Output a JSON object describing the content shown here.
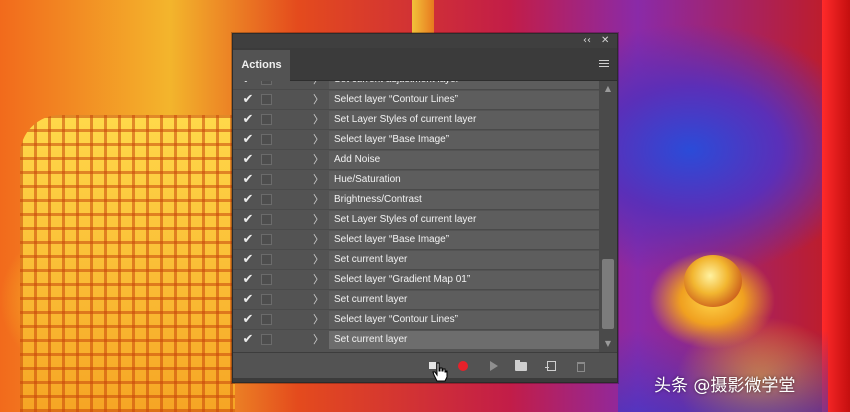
{
  "panel": {
    "title": "Actions",
    "collapse_glyph": "‹‹",
    "close_glyph": "✕",
    "menu_icon": "hamburger-menu-icon"
  },
  "actions": {
    "items": [
      {
        "label": "Set current adjustment layer",
        "checked": true
      },
      {
        "label": "Select layer “Contour Lines”",
        "checked": true
      },
      {
        "label": "Set Layer Styles of current layer",
        "checked": true
      },
      {
        "label": "Select layer “Base Image”",
        "checked": true
      },
      {
        "label": "Add Noise",
        "checked": true
      },
      {
        "label": "Hue/Saturation",
        "checked": true
      },
      {
        "label": "Brightness/Contrast",
        "checked": true
      },
      {
        "label": "Set Layer Styles of current layer",
        "checked": true
      },
      {
        "label": "Select layer “Base Image”",
        "checked": true
      },
      {
        "label": "Set current layer",
        "checked": true
      },
      {
        "label": "Select layer “Gradient Map 01”",
        "checked": true
      },
      {
        "label": "Set current layer",
        "checked": true
      },
      {
        "label": "Select layer “Contour Lines”",
        "checked": true
      },
      {
        "label": "Set current layer",
        "checked": true,
        "selected": true
      }
    ],
    "check_glyph": "✔",
    "expand_glyph": "〉"
  },
  "scrollbar": {
    "up_glyph": "▲",
    "down_glyph": "▼",
    "position": 0.95
  },
  "toolbar": {
    "buttons": [
      "stop-icon",
      "record-icon",
      "play-icon",
      "folder-icon",
      "new-item-icon",
      "trash-icon"
    ],
    "record_color": "#e7212a"
  },
  "watermark": {
    "text": "头条 @摄影微学堂"
  }
}
